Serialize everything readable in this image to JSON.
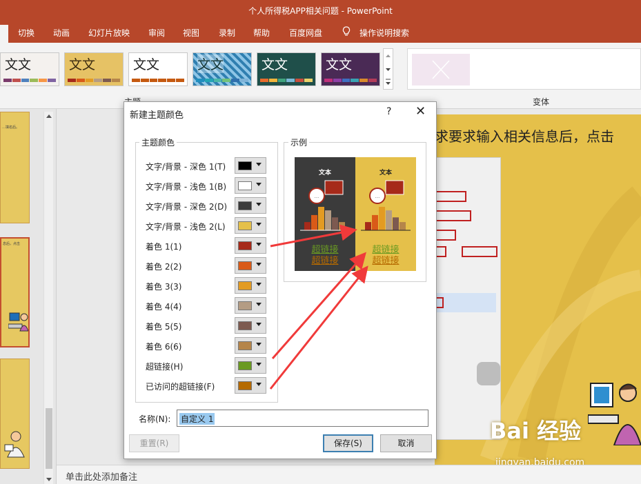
{
  "window": {
    "title": "个人所得税APP相关问题  -  PowerPoint"
  },
  "ribbon": {
    "tabs": [
      "切换",
      "动画",
      "幻灯片放映",
      "审阅",
      "视图",
      "录制",
      "帮助",
      "百度网盘",
      "操作说明搜索"
    ],
    "theme_text": "文文",
    "themes_label": "主题",
    "variants_label": "变体"
  },
  "slide": {
    "text": "求要求输入相关信息后，点击",
    "thumb1_text": "…填名后。",
    "thumb2_text": "息后，点击"
  },
  "notes": {
    "placeholder": "单击此处添加备注"
  },
  "dialog": {
    "title": "新建主题颜色",
    "help": "?",
    "close": "✕",
    "group_theme_colors": "主题颜色",
    "group_sample": "示例",
    "colors": [
      {
        "label": "文字/背景 - 深色 1(T)",
        "color": "#000000"
      },
      {
        "label": "文字/背景 - 浅色 1(B)",
        "color": "#ffffff"
      },
      {
        "label": "文字/背景 - 深色 2(D)",
        "color": "#3b3b3b"
      },
      {
        "label": "文字/背景 - 浅色 2(L)",
        "color": "#e5c04a"
      },
      {
        "label": "着色 1(1)",
        "color": "#a62a1a"
      },
      {
        "label": "着色 2(2)",
        "color": "#d95a18"
      },
      {
        "label": "着色 3(3)",
        "color": "#e39b22"
      },
      {
        "label": "着色 4(4)",
        "color": "#b49c84"
      },
      {
        "label": "着色 5(5)",
        "color": "#7d5a50"
      },
      {
        "label": "着色 6(6)",
        "color": "#b5854a"
      },
      {
        "label": "超链接(H)",
        "color": "#6a9a22"
      },
      {
        "label": "已访问的超链接(F)",
        "color": "#b56a00"
      }
    ],
    "sample": {
      "heading": "文本",
      "hyperlink": "超链接",
      "visited": "超链接",
      "bars": [
        0.35,
        0.65,
        1.0,
        0.85,
        0.55,
        0.35
      ]
    },
    "name_label": "名称(N):",
    "name_value": "自定义 1",
    "reset_label": "重置(R)",
    "save_label": "保存(S)",
    "cancel_label": "取消"
  },
  "watermark": {
    "brand": "Bai 经验",
    "url": "jingyan.baidu.com"
  }
}
